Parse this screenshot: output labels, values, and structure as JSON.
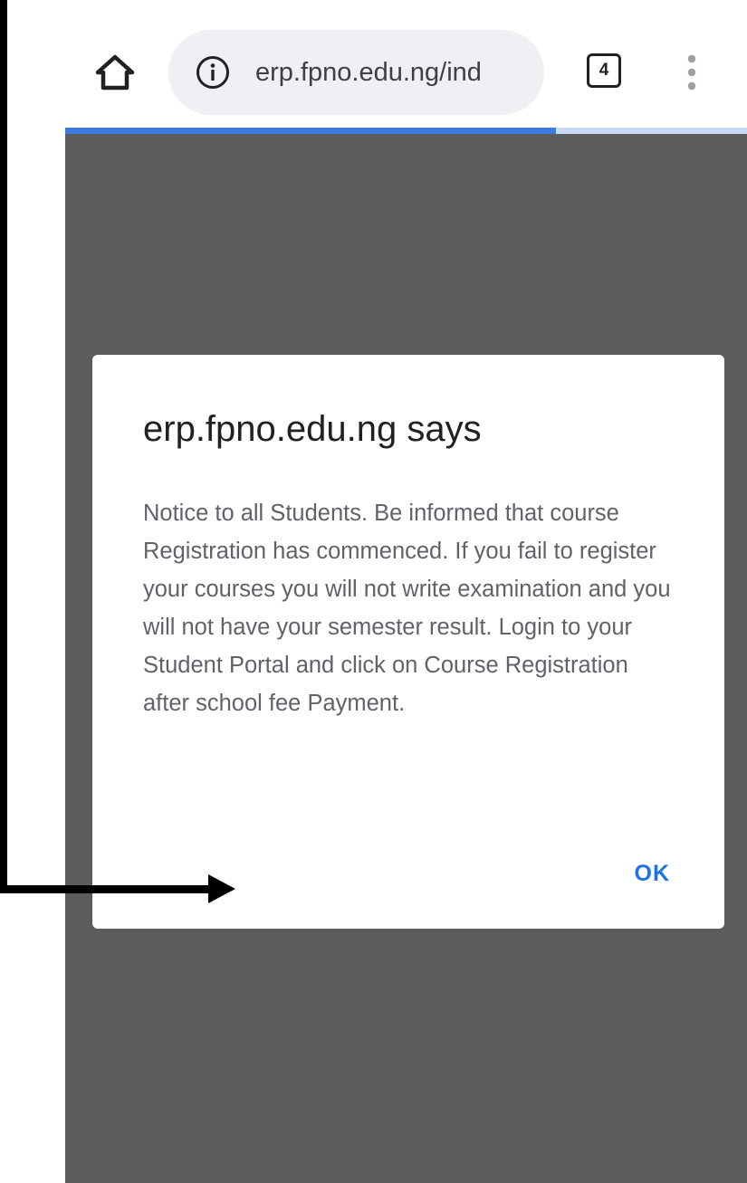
{
  "browser": {
    "url_text": "erp.fpno.edu.ng/ind",
    "tab_count": "4",
    "page_load_progress": 0.72,
    "icons": {
      "home": "home-icon",
      "info": "info-icon",
      "menu": "more-vert-icon"
    },
    "colors": {
      "progress": "#3b7be0",
      "progress_track": "#c8d9f5",
      "omnibox_bg": "#eef0f3"
    }
  },
  "dialog": {
    "title": "erp.fpno.edu.ng says",
    "message": "Notice to all Students. Be informed that course Registration has commenced. If you fail to register your courses you will not write examination and you will not have your semester result. Login to your Student Portal and click on Course Registration after school fee Payment.",
    "ok_label": "OK",
    "colors": {
      "overlay": "#5c5c5c",
      "ok_text": "#1a73e8"
    }
  },
  "annotation": {
    "type": "arrow",
    "color": "#000000"
  }
}
